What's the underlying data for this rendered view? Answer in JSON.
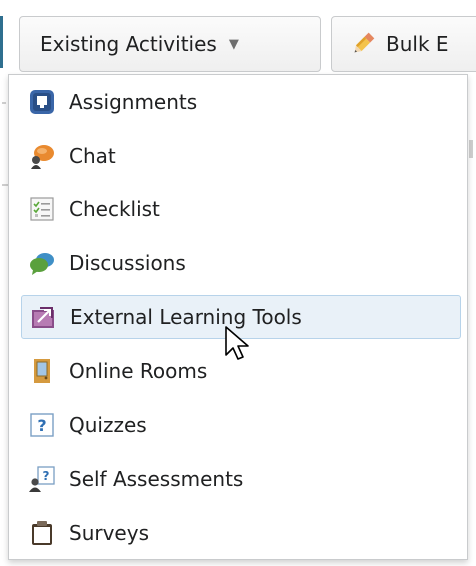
{
  "toolbar": {
    "existing_label": "Existing Activities",
    "existing_chevron_icon": "chevron-down-icon",
    "bulk_label": "Bulk E",
    "bulk_icon": "pencil-icon"
  },
  "menu": {
    "items": [
      {
        "label": "Assignments",
        "icon": "assignments-icon"
      },
      {
        "label": "Chat",
        "icon": "chat-icon"
      },
      {
        "label": "Checklist",
        "icon": "checklist-icon"
      },
      {
        "label": "Discussions",
        "icon": "discussions-icon"
      },
      {
        "label": "External Learning Tools",
        "icon": "external-learning-tools-icon"
      },
      {
        "label": "Online Rooms",
        "icon": "online-rooms-icon"
      },
      {
        "label": "Quizzes",
        "icon": "quizzes-icon"
      },
      {
        "label": "Self Assessments",
        "icon": "self-assessments-icon"
      },
      {
        "label": "Surveys",
        "icon": "surveys-icon"
      }
    ],
    "hovered_label": "External Learning Tools"
  },
  "colors": {
    "accent": "#2f6f8f",
    "hover_bg": "#e9f1f8",
    "hover_border": "#b7d3ea"
  }
}
